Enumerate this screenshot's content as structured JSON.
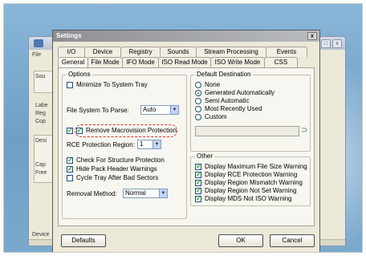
{
  "background_window": {
    "menu": "File",
    "left_labels": [
      "Sou",
      "Labe",
      "Reg",
      "Cop",
      "Desi",
      "Cap",
      "Free"
    ],
    "device_label": "Device",
    "controls": [
      "_",
      "□",
      "x"
    ]
  },
  "dialog": {
    "title": "Settings",
    "close": "x",
    "tabs_row1": [
      "I/O",
      "Device",
      "Registry",
      "Sounds",
      "Stream Processing",
      "Events"
    ],
    "tabs_row2": [
      "General",
      "File Mode",
      "IFO Mode",
      "ISO Read Mode",
      "ISO Write Mode",
      "CSS"
    ],
    "active_tab": "General",
    "options": {
      "group_label": "Options",
      "minimize_to_tray": {
        "label": "Minimize To System Tray",
        "checked": false
      },
      "file_system_label": "File System To Parse:",
      "file_system_value": "Auto",
      "remove_macrovision": {
        "label": "Remove Macrovision Protection",
        "checked": true
      },
      "rce_label": "RCE Protection Region:",
      "rce_value": "1",
      "check_structure": {
        "label": "Check For Structure Protection",
        "checked": true
      },
      "hide_pack_header": {
        "label": "Hide Pack Header Warnings",
        "checked": true
      },
      "cycle_tray": {
        "label": "Cycle Tray After Bad Sectors",
        "checked": false
      },
      "removal_method_label": "Removal Method:",
      "removal_method_value": "Normal"
    },
    "destination": {
      "group_label": "Default Destination",
      "options": [
        {
          "label": "None",
          "selected": false
        },
        {
          "label": "Generated Automatically",
          "selected": true
        },
        {
          "label": "Semi Automatic",
          "selected": false
        },
        {
          "label": "Most Recently Used",
          "selected": false
        },
        {
          "label": "Custom",
          "selected": false
        }
      ],
      "custom_path": ""
    },
    "other": {
      "group_label": "Other",
      "items": [
        {
          "label": "Display Maximum File Size Warning",
          "checked": true
        },
        {
          "label": "Display RCE Protection Warning",
          "checked": true
        },
        {
          "label": "Display Region Mismatch Warning",
          "checked": true
        },
        {
          "label": "Display Region Not Set Warning",
          "checked": true
        },
        {
          "label": "Display MDS Not ISO Warning",
          "checked": true
        }
      ]
    },
    "buttons": {
      "defaults": "Defaults",
      "ok": "OK",
      "cancel": "Cancel"
    }
  }
}
